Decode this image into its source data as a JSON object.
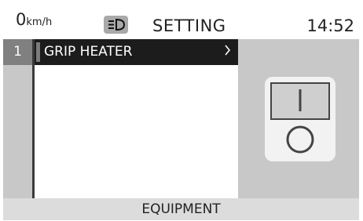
{
  "header": {
    "speed_value": "0",
    "speed_unit": "km/h",
    "title": "SETTING",
    "time": "14:52",
    "headlight_icon": "headlight-icon"
  },
  "menu": {
    "index": "1",
    "items": [
      {
        "label": "GRIP HEATER",
        "arrow_icon": "chevron-right-icon"
      }
    ]
  },
  "preview": {
    "icon": "grip-heater-switch-icon"
  },
  "footer": {
    "label": "EQUIPMENT"
  },
  "colors": {
    "selected_row": "#1c1c1c",
    "panel_gray": "#c8c8c8",
    "index_gray": "#808080",
    "footer_gray": "#dcdcdc"
  }
}
